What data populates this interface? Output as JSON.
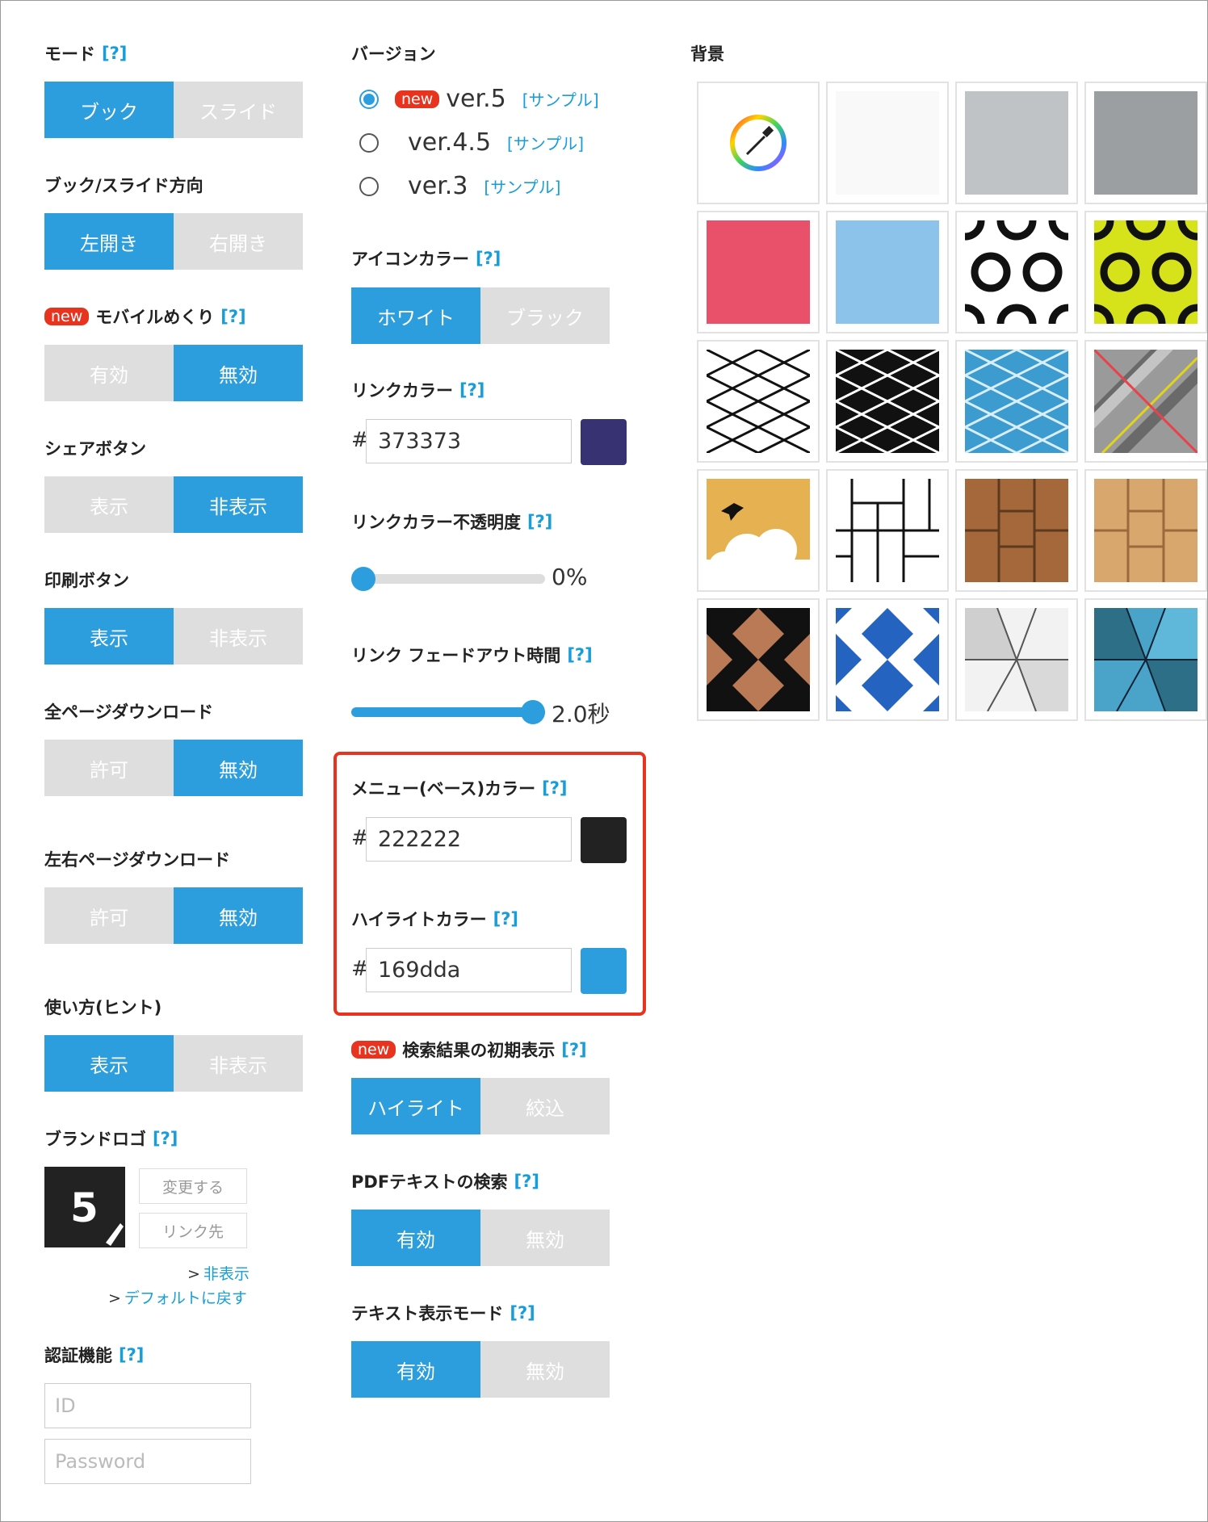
{
  "help": "[?]",
  "new_badge": "new",
  "left": {
    "mode": {
      "label": "モード",
      "options": [
        "ブック",
        "スライド"
      ],
      "selected": 0
    },
    "direction": {
      "label": "ブック/スライド方向",
      "options": [
        "左開き",
        "右開き"
      ],
      "selected": 0
    },
    "mobile_flip": {
      "label": "モバイルめくり",
      "options": [
        "有効",
        "無効"
      ],
      "selected": 1
    },
    "share": {
      "label": "シェアボタン",
      "options": [
        "表示",
        "非表示"
      ],
      "selected": 1
    },
    "print": {
      "label": "印刷ボタン",
      "options": [
        "表示",
        "非表示"
      ],
      "selected": 0
    },
    "all_download": {
      "label": "全ページダウンロード",
      "options": [
        "許可",
        "無効"
      ],
      "selected": 1
    },
    "lr_download": {
      "label": "左右ページダウンロード",
      "options": [
        "許可",
        "無効"
      ],
      "selected": 1
    },
    "hint": {
      "label": "使い方(ヒント)",
      "options": [
        "表示",
        "非表示"
      ],
      "selected": 0
    },
    "brand": {
      "label": "ブランドロゴ",
      "logo_text": "5",
      "change": "変更する",
      "link": "リンク先",
      "hide": "非表示",
      "reset": "デフォルトに戻す",
      "gt": ">"
    },
    "auth": {
      "label": "認証機能",
      "id_placeholder": "ID",
      "password_placeholder": "Password"
    }
  },
  "middle": {
    "version": {
      "label": "バージョン",
      "sample": "[サンプル]",
      "options": [
        "ver.5",
        "ver.4.5",
        "ver.3"
      ],
      "selected": 0
    },
    "icon_color": {
      "label": "アイコンカラー",
      "options": [
        "ホワイト",
        "ブラック"
      ],
      "selected": 0
    },
    "link_color": {
      "label": "リンクカラー",
      "hash": "#",
      "value": "373373",
      "swatch": "#373373"
    },
    "link_opacity": {
      "label": "リンクカラー不透明度",
      "value_text": "0%",
      "value": 0
    },
    "link_fade": {
      "label": "リンク フェードアウト時間",
      "value_text": "2.0秒",
      "value": 1.0
    },
    "menu_color": {
      "label": "メニュー(ベース)カラー",
      "hash": "#",
      "value": "222222",
      "swatch": "#222222"
    },
    "highlight_color": {
      "label": "ハイライトカラー",
      "hash": "#",
      "value": "169dda",
      "swatch": "#2c9ede"
    },
    "search_initial": {
      "label": "検索結果の初期表示",
      "options": [
        "ハイライト",
        "絞込"
      ],
      "selected": 0
    },
    "pdf_search": {
      "label": "PDFテキストの検索",
      "options": [
        "有効",
        "無効"
      ],
      "selected": 0
    },
    "text_mode": {
      "label": "テキスト表示モード",
      "options": [
        "有効",
        "無効"
      ],
      "selected": 0
    }
  },
  "right": {
    "background": {
      "label": "背景"
    }
  },
  "colors": {
    "accent": "#2c9ede",
    "inactive": "#dedede",
    "highlight_box": "#e8341f",
    "help": "#169dda"
  }
}
